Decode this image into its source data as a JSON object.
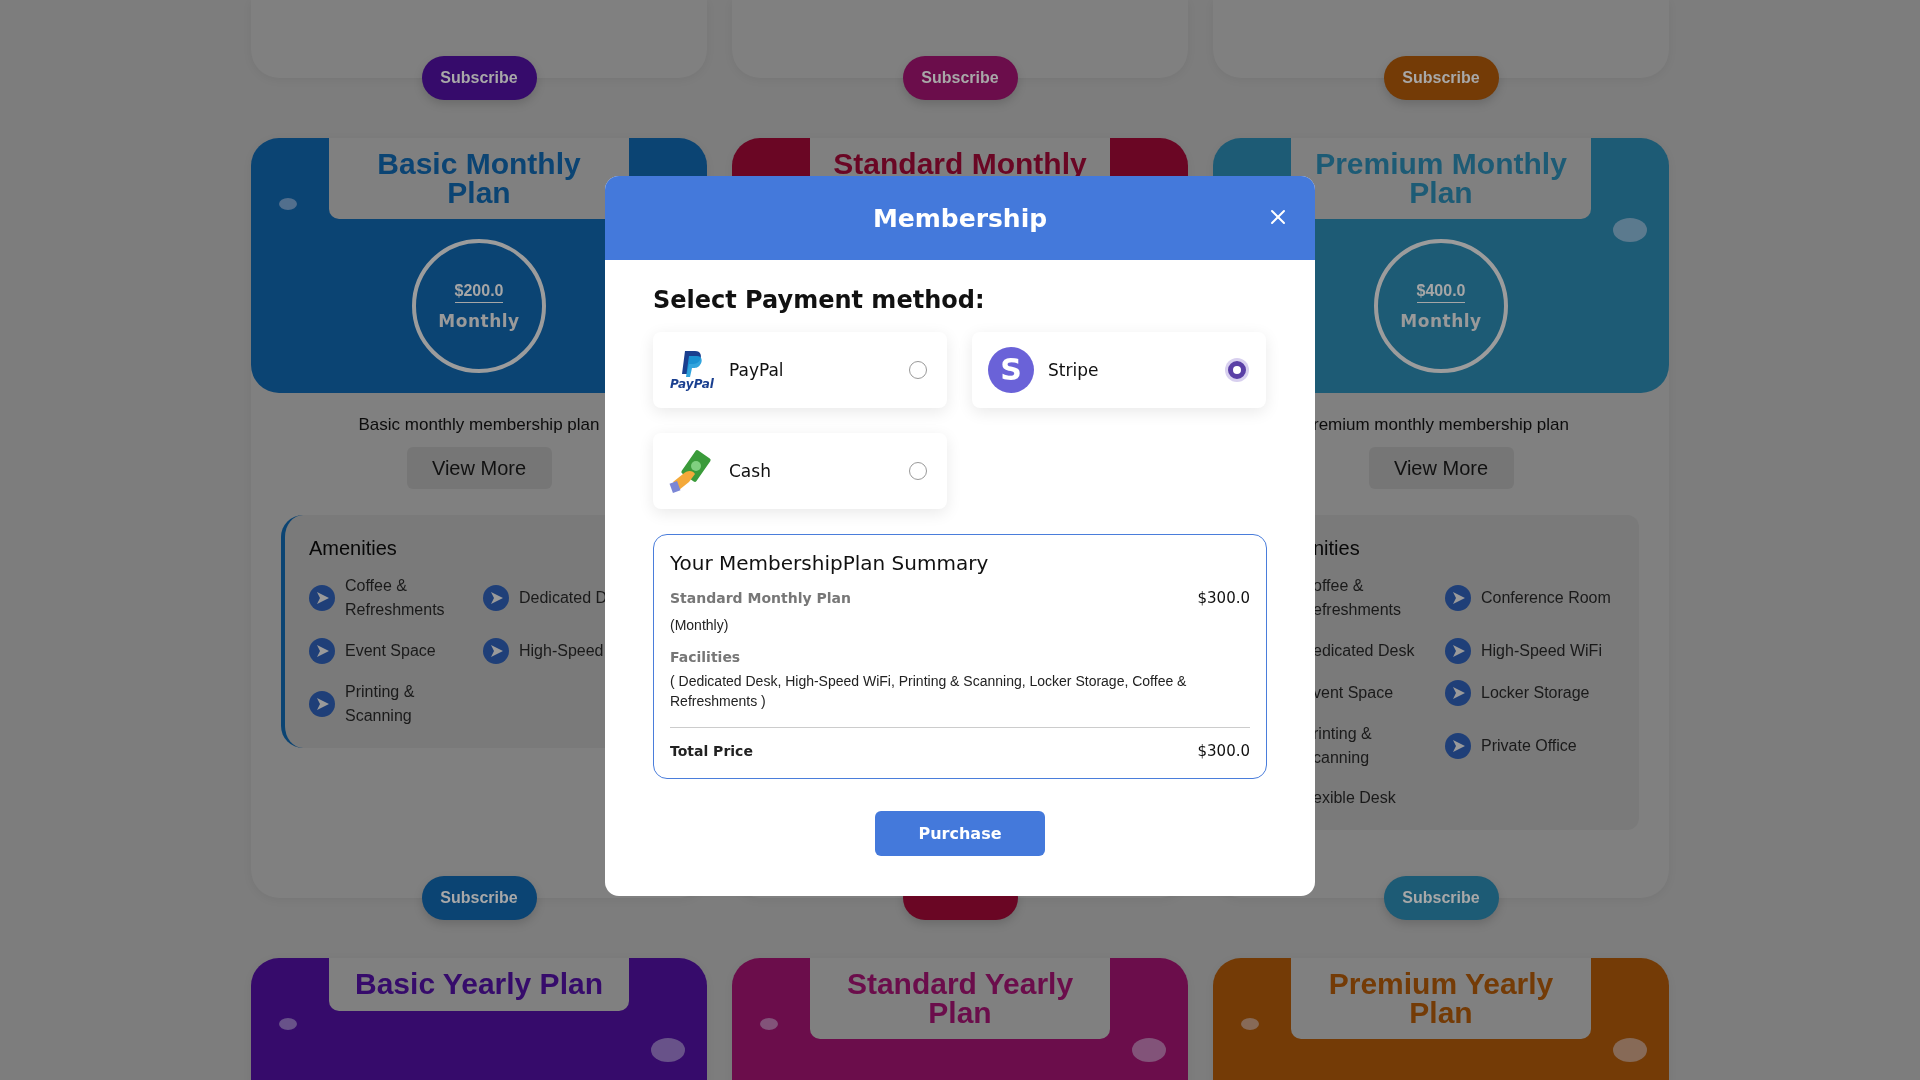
{
  "plan_rows": [
    {
      "cards": [
        {
          "color": "#360b6b",
          "subscribe": "Subscribe"
        },
        {
          "color": "#6b0d4b",
          "subscribe": "Subscribe"
        },
        {
          "color": "#743b06",
          "subscribe": "Subscribe"
        }
      ]
    },
    {
      "cards": [
        {
          "color": "#0b4473",
          "title": "Basic Monthly Plan",
          "price": "$200.0",
          "period": "Monthly",
          "description": "Basic monthly membership plan",
          "view_more": "View More",
          "amenities": {
            "title": "Amenities",
            "kind": "full",
            "items": [
              {
                "label": "Coffee & Refreshments",
                "kind": "full"
              },
              {
                "label": "Dedicated D",
                "kind": "full"
              },
              {
                "label": "Event Space",
                "kind": "full"
              },
              {
                "label": "High-Speed",
                "kind": "full"
              },
              {
                "label": "Printing & Scanning",
                "kind": "full"
              }
            ]
          },
          "subscribe": "Subscribe"
        },
        {
          "color": "#6a0624",
          "title": "Standard Monthly"
        },
        {
          "color": "#1d5b75",
          "title": "Premium Monthly Plan",
          "price": "$400.0",
          "period": "Monthly",
          "description": "remium monthly membership plan",
          "view_more": "View More",
          "amenities": {
            "title": "nities",
            "kind": "cut",
            "items": [
              {
                "label": "offee & efreshments",
                "kind": "cut"
              },
              {
                "label": "Conference Room",
                "kind": "full"
              },
              {
                "label": "edicated Desk",
                "kind": "cut"
              },
              {
                "label": "High-Speed WiFi",
                "kind": "full"
              },
              {
                "label": "vent Space",
                "kind": "cut"
              },
              {
                "label": "Locker Storage",
                "kind": "full"
              },
              {
                "label": "rinting & canning",
                "kind": "cut"
              },
              {
                "label": "Private Office",
                "kind": "full"
              },
              {
                "label": "exible Desk",
                "kind": "cut"
              }
            ]
          },
          "subscribe": "Subscribe"
        }
      ]
    },
    {
      "cards": [
        {
          "color": "#360b6b",
          "title": "Basic Yearly Plan"
        },
        {
          "color": "#6b0d4b",
          "title": "Standard Yearly Plan"
        },
        {
          "color": "#743b06",
          "title": "Premium Yearly Plan"
        }
      ]
    }
  ],
  "modal": {
    "title": "Membership",
    "section_title": "Select Payment method:",
    "payment_methods": [
      {
        "kind": "paypal",
        "logo_text": "PayPal",
        "label": "PayPal",
        "selected": false
      },
      {
        "kind": "stripe",
        "logo_text": "S",
        "label": "Stripe",
        "selected": true
      },
      {
        "kind": "cash",
        "label": "Cash",
        "selected": false
      }
    ],
    "summary": {
      "title": "Your MembershipPlan Summary",
      "plan": "Standard Monthly Plan",
      "price": "$300.0",
      "period": "(Monthly)",
      "facilities_label": "Facilities",
      "facilities": "( Dedicated Desk, High-Speed WiFi, Printing & Scanning, Locker Storage, Coffee & Refreshments )",
      "total_label": "Total Price",
      "total": "$300.0"
    },
    "purchase": "Purchase"
  }
}
